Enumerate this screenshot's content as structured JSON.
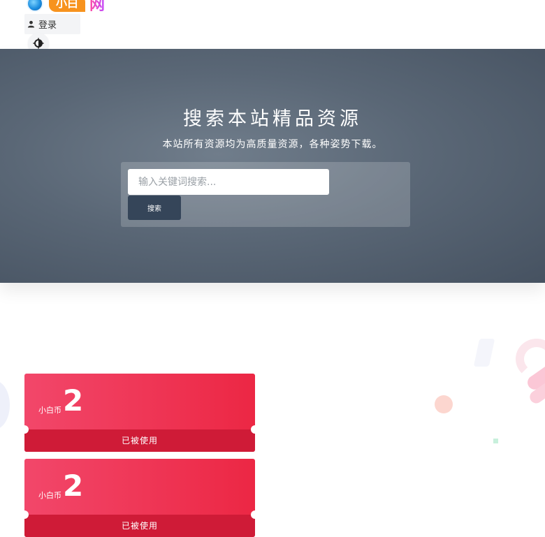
{
  "header": {
    "logo": {
      "tag_text": "小白",
      "suffix_text": "网"
    },
    "login_label": "登录",
    "icons": {
      "user": "user-icon",
      "theme": "theme-toggle-icon",
      "menu": "menu-icon"
    }
  },
  "hero": {
    "title": "搜索本站精品资源",
    "subtitle": "本站所有资源均为高质量资源，各种姿势下载。",
    "search": {
      "placeholder": "输入关键词搜索...",
      "button_label": "搜索"
    }
  },
  "coupons": [
    {
      "unit": "小白币",
      "amount": "2",
      "status": "已被使用"
    },
    {
      "unit": "小白币",
      "amount": "2",
      "status": "已被使用"
    }
  ],
  "colors": {
    "hero_bg": "#5a6776",
    "search_button": "#354559",
    "coupon_red": "#ec2744",
    "coupon_status": "#cf1b37",
    "logo_orange": "#f7931e",
    "logo_pink": "#ff4fa3"
  }
}
